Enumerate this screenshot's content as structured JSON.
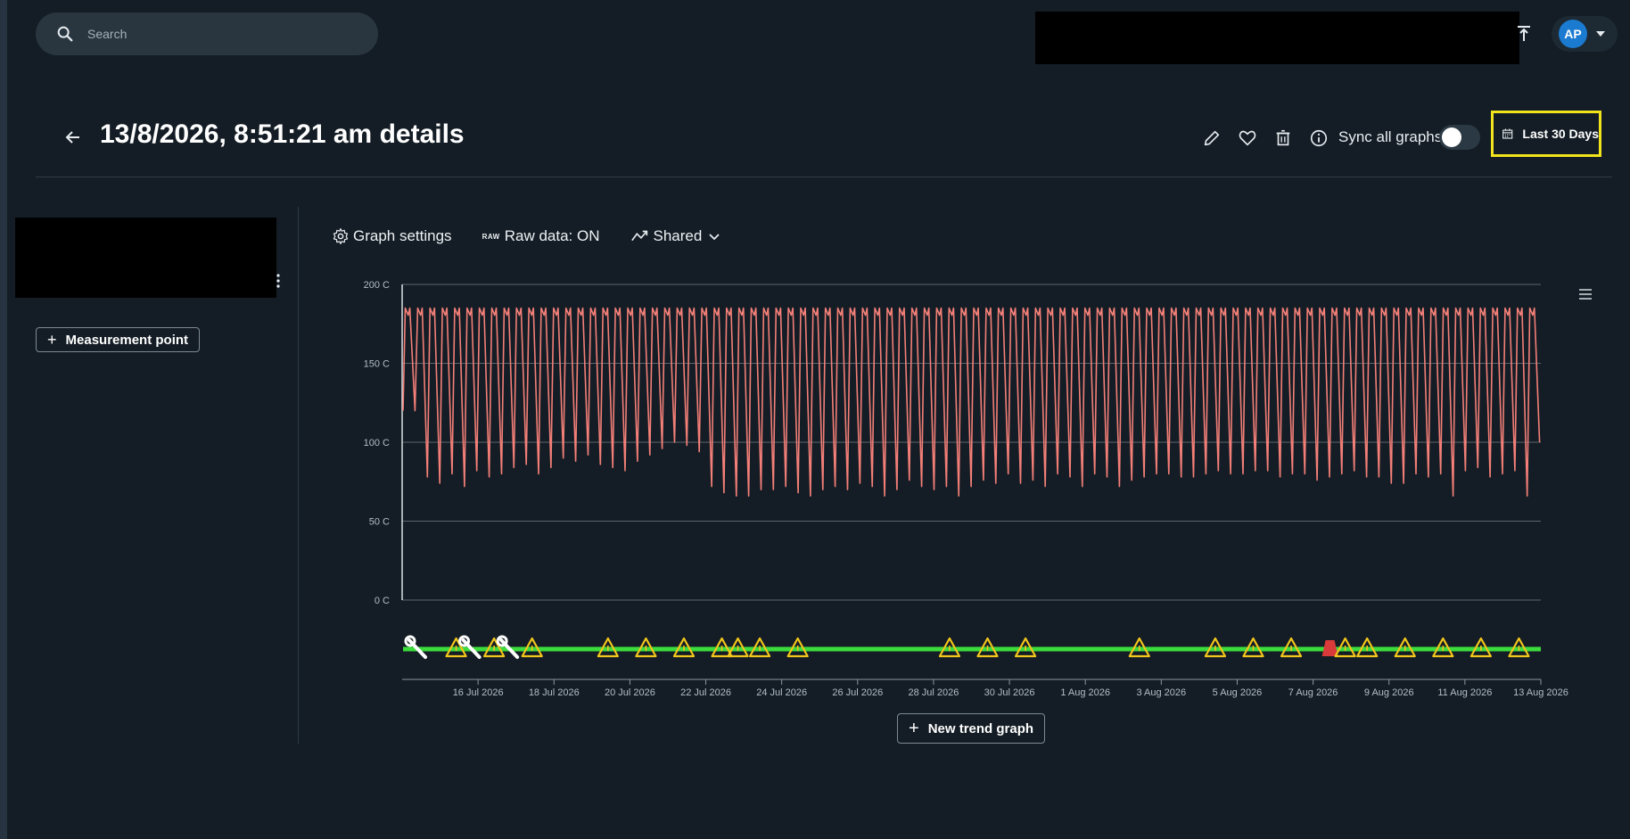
{
  "topbar": {
    "search_placeholder": "Search",
    "user_initials": "AP"
  },
  "header": {
    "title": "13/8/2026, 8:51:21 am details",
    "sync_label": "Sync all graphs",
    "sync_enabled": false,
    "date_range": "Last 30 Days",
    "date_range_highlight_color": "#f2e41c"
  },
  "sidebar": {
    "add_measurement_label": "Measurement point"
  },
  "graph_toolbar": {
    "settings_label": "Graph settings",
    "raw_tag": "RAW",
    "raw_label": "Raw data: ON",
    "shared_label": "Shared"
  },
  "new_trend_label": "New trend graph",
  "chart_data": {
    "type": "line",
    "series": [
      {
        "color": "#f37f78",
        "y_high": 185,
        "y_low_values": [
          120,
          78,
          74,
          80,
          72,
          82,
          78,
          80,
          84,
          86,
          80,
          84,
          90,
          88,
          92,
          86,
          84,
          82,
          88,
          92,
          96,
          100,
          98,
          94,
          72,
          68,
          66,
          66,
          70,
          70,
          72,
          68,
          66,
          70,
          72,
          70,
          74,
          72,
          66,
          70,
          76,
          72,
          70,
          72,
          66,
          72,
          76,
          74,
          80,
          74,
          76,
          72,
          80,
          78,
          72,
          80,
          78,
          72,
          76,
          78,
          80,
          80,
          78,
          78,
          80,
          82,
          80,
          80,
          82,
          82,
          78,
          80,
          80,
          76,
          78,
          80,
          82,
          78,
          78,
          74,
          74,
          80,
          78,
          80,
          66,
          82,
          84,
          78,
          80,
          82,
          66,
          100
        ]
      }
    ],
    "y_axis": {
      "ylim": [
        0,
        200
      ],
      "ticks": [
        "0 C",
        "50 C",
        "100 C",
        "150 C",
        "200 C"
      ],
      "tick_values": [
        0,
        50,
        100,
        150,
        200
      ]
    },
    "x_axis": {
      "range": [
        "2026-07-14",
        "2026-08-13"
      ],
      "ticks": [
        "16 Jul 2026",
        "18 Jul 2026",
        "20 Jul 2026",
        "22 Jul 2026",
        "24 Jul 2026",
        "26 Jul 2026",
        "28 Jul 2026",
        "30 Jul 2026",
        "1 Aug 2026",
        "3 Aug 2026",
        "5 Aug 2026",
        "7 Aug 2026",
        "9 Aug 2026",
        "11 Aug 2026",
        "13 Aug 2026"
      ]
    },
    "status_track": {
      "color": "#3ddc3d",
      "events": [
        {
          "type": "maintenance",
          "date": "2026-07-14"
        },
        {
          "type": "warning",
          "date": "2026-07-15"
        },
        {
          "type": "maintenance",
          "date": "2026-07-15"
        },
        {
          "type": "warning",
          "date": "2026-07-16"
        },
        {
          "type": "maintenance",
          "date": "2026-07-16"
        },
        {
          "type": "warning",
          "date": "2026-07-17"
        },
        {
          "type": "warning",
          "date": "2026-07-19"
        },
        {
          "type": "warning",
          "date": "2026-07-20"
        },
        {
          "type": "warning",
          "date": "2026-07-21"
        },
        {
          "type": "warning",
          "date": "2026-07-22"
        },
        {
          "type": "warning",
          "date": "2026-07-22"
        },
        {
          "type": "warning",
          "date": "2026-07-23"
        },
        {
          "type": "warning",
          "date": "2026-07-24"
        },
        {
          "type": "warning",
          "date": "2026-07-28"
        },
        {
          "type": "warning",
          "date": "2026-07-29"
        },
        {
          "type": "warning",
          "date": "2026-07-30"
        },
        {
          "type": "warning",
          "date": "2026-08-02"
        },
        {
          "type": "warning",
          "date": "2026-08-04"
        },
        {
          "type": "warning",
          "date": "2026-08-05"
        },
        {
          "type": "warning",
          "date": "2026-08-06"
        },
        {
          "type": "alarm",
          "date": "2026-08-07"
        },
        {
          "type": "warning",
          "date": "2026-08-07"
        },
        {
          "type": "warning",
          "date": "2026-08-08"
        },
        {
          "type": "warning",
          "date": "2026-08-09"
        },
        {
          "type": "warning",
          "date": "2026-08-10"
        },
        {
          "type": "warning",
          "date": "2026-08-11"
        },
        {
          "type": "warning",
          "date": "2026-08-12"
        }
      ]
    }
  },
  "icons": {
    "search": "search-icon",
    "upload": "upload-icon",
    "back": "arrow-left-icon",
    "edit": "pencil-icon",
    "favorite": "heart-icon",
    "delete": "trash-icon",
    "info": "info-icon",
    "calendar": "calendar-icon",
    "settings": "gear-icon",
    "shared": "trend-icon",
    "menu": "hamburger-icon",
    "more": "kebab-icon"
  }
}
